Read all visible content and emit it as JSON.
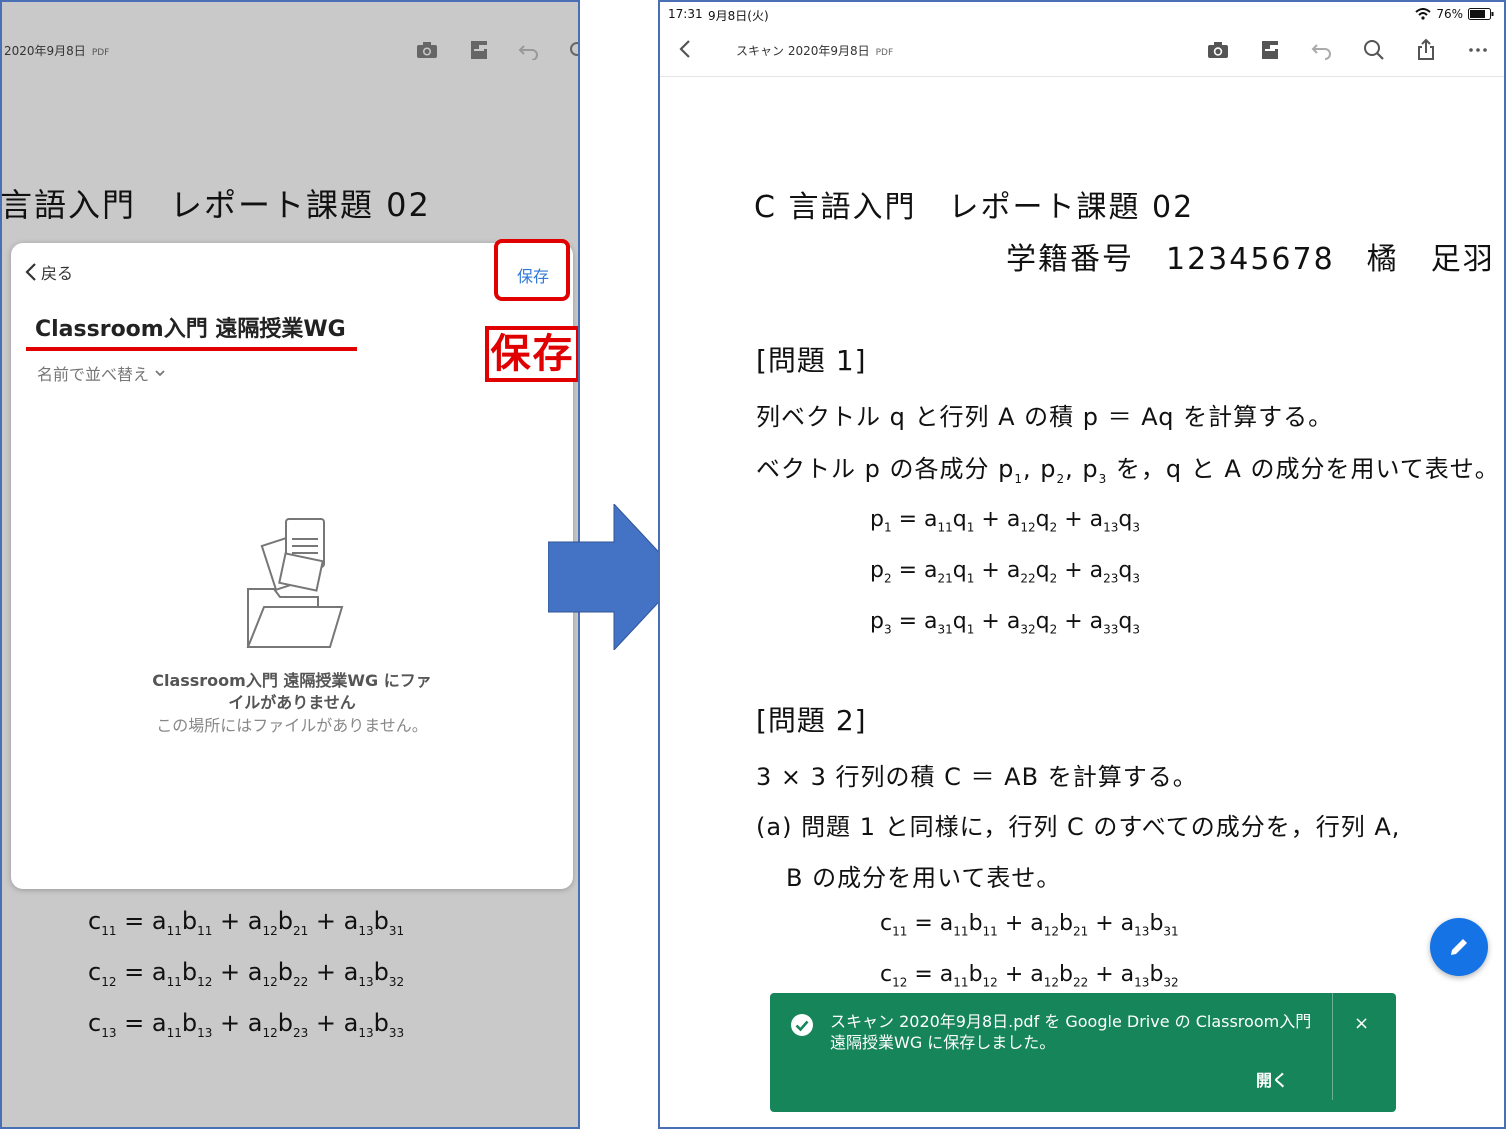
{
  "left_panel": {
    "file_name": "2020年9月8日",
    "file_type": "PDF",
    "doc_title_fragment": "言語入門　レポート課題 02",
    "doc_equations": [
      {
        "lhs": "c",
        "lhs_sub": "11",
        "a1": "11",
        "b1": "11",
        "a2": "12",
        "b2": "21",
        "a3": "13",
        "b3": "31"
      },
      {
        "lhs": "c",
        "lhs_sub": "12",
        "a1": "11",
        "b1": "12",
        "a2": "12",
        "b2": "22",
        "a3": "13",
        "b3": "32"
      },
      {
        "lhs": "c",
        "lhs_sub": "13",
        "a1": "11",
        "b1": "13",
        "a2": "12",
        "b2": "23",
        "a3": "13",
        "b3": "33"
      }
    ],
    "sheet": {
      "back_label": "戻る",
      "save_label": "保存",
      "folder_title": "Classroom入門 遠隔授業WG",
      "sort_label": "名前で並べ替え",
      "empty_title": "Classroom入門 遠隔授業WG にファイルがありません",
      "empty_subtitle": "この場所にはファイルがありません。"
    },
    "callout_label": "保存"
  },
  "right_panel": {
    "status": {
      "time": "17:31",
      "date": "9月8日(火)",
      "battery": "76%"
    },
    "file_name": "スキャン 2020年9月8日",
    "file_type": "PDF",
    "toolbar_icons": [
      "camera-icon",
      "organize-pages-icon",
      "undo-icon",
      "search-icon",
      "share-icon",
      "more-icon"
    ],
    "doc": {
      "title": "C 言語入門　レポート課題 02",
      "student": "学籍番号　12345678　橘　足羽",
      "q1_heading": "[問題 1]",
      "q1_line1": "列ベクトル q と行列 A の積 p ＝ Aq を計算する。",
      "q1_line2_a": "ベクトル p の各成分 p",
      "q1_line2_b": "を，q と A の成分を用いて表せ。",
      "q1_eqs": [
        {
          "lhs_sub": "1",
          "t": [
            [
              "11",
              "1"
            ],
            [
              "12",
              "2"
            ],
            [
              "13",
              "3"
            ]
          ]
        },
        {
          "lhs_sub": "2",
          "t": [
            [
              "21",
              "1"
            ],
            [
              "22",
              "2"
            ],
            [
              "23",
              "3"
            ]
          ]
        },
        {
          "lhs_sub": "3",
          "t": [
            [
              "31",
              "1"
            ],
            [
              "32",
              "2"
            ],
            [
              "33",
              "3"
            ]
          ]
        }
      ],
      "q2_heading": "[問題 2]",
      "q2_line1": "3 × 3 行列の積 C ＝ AB を計算する。",
      "q2_line2": "(a)  問題 1 と同様に，行列 C のすべての成分を，行列 A,",
      "q2_line3": "B の成分を用いて表せ。",
      "q2_eqs": [
        {
          "lhs_sub": "11",
          "t": [
            [
              "11",
              "11"
            ],
            [
              "12",
              "21"
            ],
            [
              "13",
              "31"
            ]
          ]
        },
        {
          "lhs_sub": "12",
          "t": [
            [
              "11",
              "12"
            ],
            [
              "12",
              "22"
            ],
            [
              "13",
              "32"
            ]
          ]
        }
      ]
    },
    "toast": {
      "message": "スキャン 2020年9月8日.pdf を Google Drive の Classroom入門 遠隔授業WG に保存しました。",
      "action_label": "開く",
      "close_label": "×",
      "color": "#16855a"
    },
    "fab_icon": "pencil-icon"
  },
  "colors": {
    "annotation_red": "#e10000",
    "link_blue": "#2f7ad6",
    "fab_blue": "#1573e6",
    "arrow_blue": "#4472c4"
  }
}
